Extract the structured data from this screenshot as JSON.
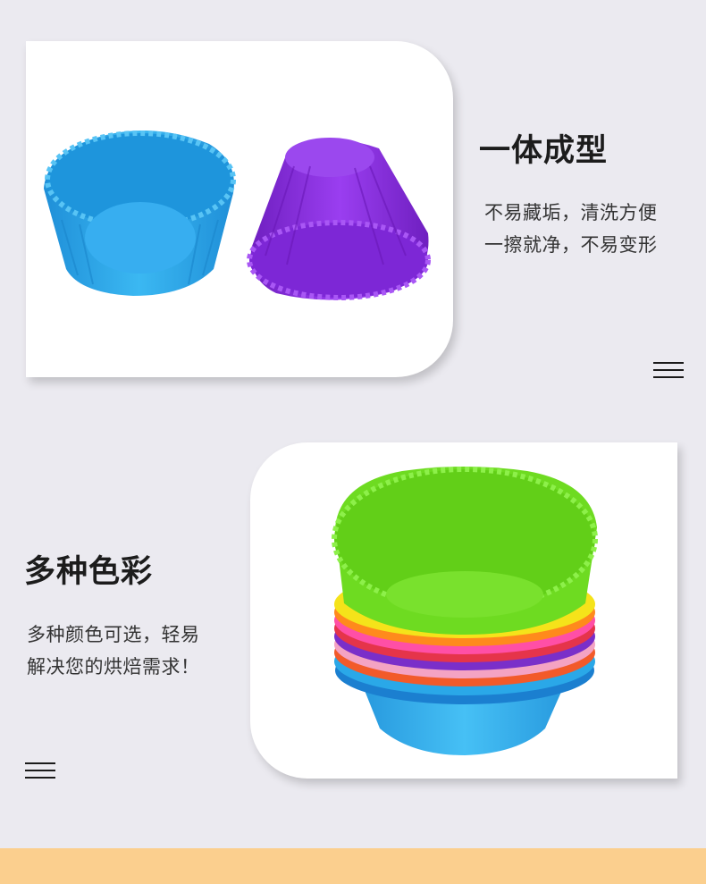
{
  "feature1": {
    "title": "一体成型",
    "desc_line1": "不易藏垢，清洗方便",
    "desc_line2": "一擦就净，不易变形",
    "menu_icon": "hamburger-menu-icon"
  },
  "feature2": {
    "title": "多种色彩",
    "desc_line1": "多种颜色可选，轻易",
    "desc_line2": "解决您的烘焙需求！",
    "menu_icon": "hamburger-menu-icon"
  },
  "colors": {
    "background": "#ebeaf0",
    "card": "#ffffff",
    "bottom_band": "#fbcf8e",
    "cup_blue": "#2aa8e8",
    "cup_purple": "#8a2be2",
    "cup_green": "#6edb21"
  }
}
